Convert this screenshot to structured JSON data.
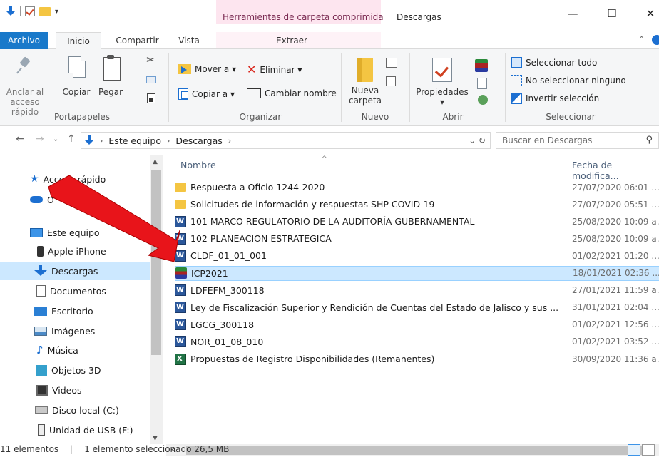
{
  "titlebar": {
    "context_tab": "Herramientas de carpeta comprimida",
    "window_title": "Descargas",
    "min": "—",
    "max": "☐",
    "close": "✕"
  },
  "tabs": {
    "archivo": "Archivo",
    "inicio": "Inicio",
    "compartir": "Compartir",
    "vista": "Vista",
    "extraer": "Extraer"
  },
  "ribbon": {
    "pin_label_1": "Anclar al",
    "pin_label_2": "acceso rápido",
    "copy": "Copiar",
    "paste": "Pegar",
    "group_clipboard": "Portapapeles",
    "move_to": "Mover a ▾",
    "copy_to": "Copiar a ▾",
    "delete": "Eliminar ▾",
    "rename": "Cambiar nombre",
    "group_organize": "Organizar",
    "new_folder_1": "Nueva",
    "new_folder_2": "carpeta",
    "group_new": "Nuevo",
    "properties": "Propiedades",
    "properties_drop": "▾",
    "group_open": "Abrir",
    "select_all": "Seleccionar todo",
    "select_none": "No seleccionar ninguno",
    "invert": "Invertir selección",
    "group_select": "Seleccionar"
  },
  "address": {
    "crumbs": [
      "Este equipo",
      "Descargas"
    ],
    "search_placeholder": "Buscar en Descargas"
  },
  "nav": {
    "items": [
      {
        "label": "Acceso rápido",
        "icon": "star-icon"
      },
      {
        "label": "O",
        "icon": "onedrive-icon"
      },
      {
        "label": "Este equipo",
        "icon": "pc-icon"
      },
      {
        "label": "Apple iPhone",
        "icon": "phone-icon"
      },
      {
        "label": "Descargas",
        "icon": "downloads-icon"
      },
      {
        "label": "Documentos",
        "icon": "document-icon"
      },
      {
        "label": "Escritorio",
        "icon": "desktop-icon"
      },
      {
        "label": "Imágenes",
        "icon": "pictures-icon"
      },
      {
        "label": "Música",
        "icon": "music-icon"
      },
      {
        "label": "Objetos 3D",
        "icon": "3d-objects-icon"
      },
      {
        "label": "Videos",
        "icon": "videos-icon"
      },
      {
        "label": "Disco local (C:)",
        "icon": "disk-icon"
      },
      {
        "label": "Unidad de USB (F:)",
        "icon": "usb-icon"
      }
    ]
  },
  "files": {
    "col_name": "Nombre",
    "col_date": "Fecha de modifica...",
    "rows": [
      {
        "name": "Respuesta a Oficio 1244-2020",
        "date": "27/07/2020 06:01 ...",
        "type": "folder"
      },
      {
        "name": "Solicitudes de información y respuestas SHP COVID-19",
        "date": "27/07/2020 05:51 ...",
        "type": "folder"
      },
      {
        "name": "101 MARCO REGULATORIO DE LA AUDITORÍA GUBERNAMENTAL",
        "date": "25/08/2020 10:09 a...",
        "type": "word"
      },
      {
        "name": "102 PLANEACION ESTRATEGICA",
        "date": "25/08/2020 10:09 a...",
        "type": "word"
      },
      {
        "name": "CLDF_01_01_001",
        "date": "01/02/2021 01:20 ...",
        "type": "word"
      },
      {
        "name": "ICP2021",
        "date": "18/01/2021 02:36 ...",
        "type": "rar"
      },
      {
        "name": "LDFEFM_300118",
        "date": "27/01/2021 11:59 a...",
        "type": "word"
      },
      {
        "name": "Ley de Fiscalización Superior y Rendición de Cuentas del Estado de Jalisco y sus ...",
        "date": "31/01/2021 02:04 ...",
        "type": "word"
      },
      {
        "name": "LGCG_300118",
        "date": "01/02/2021 12:56 ...",
        "type": "word"
      },
      {
        "name": "NOR_01_08_010",
        "date": "01/02/2021 03:52 ...",
        "type": "word"
      },
      {
        "name": "Propuestas de Registro Disponibilidades (Remanentes)",
        "date": "30/09/2020 11:36 a...",
        "type": "excel"
      }
    ],
    "selected_index": 5
  },
  "status": {
    "count": "11 elementos",
    "selection": "1 elemento seleccionado  26,5 MB"
  },
  "colors": {
    "accent": "#1979ca",
    "selection": "#cce8ff",
    "arrow": "#e8141a"
  }
}
